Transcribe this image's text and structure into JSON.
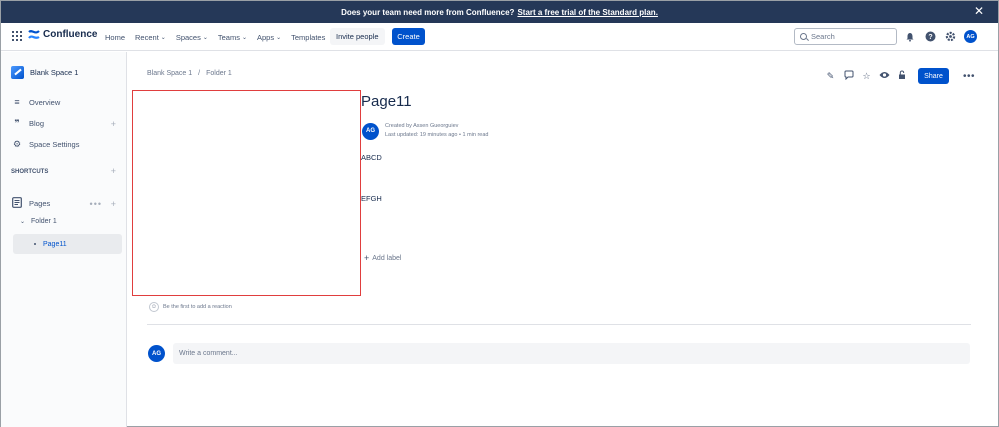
{
  "banner": {
    "text": "Does your team need more from Confluence?",
    "link": "Start a free trial of the Standard plan."
  },
  "topnav": {
    "logo_text": "Confluence",
    "items": [
      {
        "label": "Home",
        "has_dropdown": false
      },
      {
        "label": "Recent",
        "has_dropdown": true
      },
      {
        "label": "Spaces",
        "has_dropdown": true
      },
      {
        "label": "Teams",
        "has_dropdown": true
      },
      {
        "label": "Apps",
        "has_dropdown": true
      },
      {
        "label": "Templates",
        "has_dropdown": false
      }
    ],
    "invite_label": "Invite people",
    "create_label": "Create",
    "search_placeholder": "Search",
    "avatar_initials": "AG",
    "icons": [
      "notifications-icon",
      "help-icon",
      "settings-icon"
    ]
  },
  "sidebar": {
    "space_name": "Blank Space 1",
    "items": [
      {
        "label": "Overview",
        "icon": "overview-icon"
      },
      {
        "label": "Blog",
        "icon": "quote-icon"
      },
      {
        "label": "Space Settings",
        "icon": "gear-icon"
      }
    ],
    "shortcuts_label": "SHORTCUTS",
    "pages_label": "Pages",
    "folder_label": "Folder 1",
    "page_label": "Page11"
  },
  "breadcrumb": [
    "Blank Space 1",
    "/",
    "Folder 1"
  ],
  "actions": {
    "share_label": "Share",
    "icons": [
      "edit-icon",
      "comment-icon",
      "star-icon",
      "watch-icon",
      "restrictions-icon",
      "more-icon"
    ]
  },
  "page": {
    "title": "Page11",
    "author_initials": "AG",
    "created_by": "Created by Assen Gueorguiev",
    "last_updated": "Last updated: 19 minutes ago",
    "read_time": "1 min read",
    "paragraphs": [
      "ABCD",
      "EFGH"
    ],
    "add_label": "Add label",
    "reaction_text": "Be the first to add a reaction",
    "comment_placeholder": "Write a comment...",
    "comment_avatar": "AG"
  },
  "colors": {
    "banner_bg": "#253858",
    "primary": "#0052cc",
    "highlight_border": "#e03e3e"
  }
}
